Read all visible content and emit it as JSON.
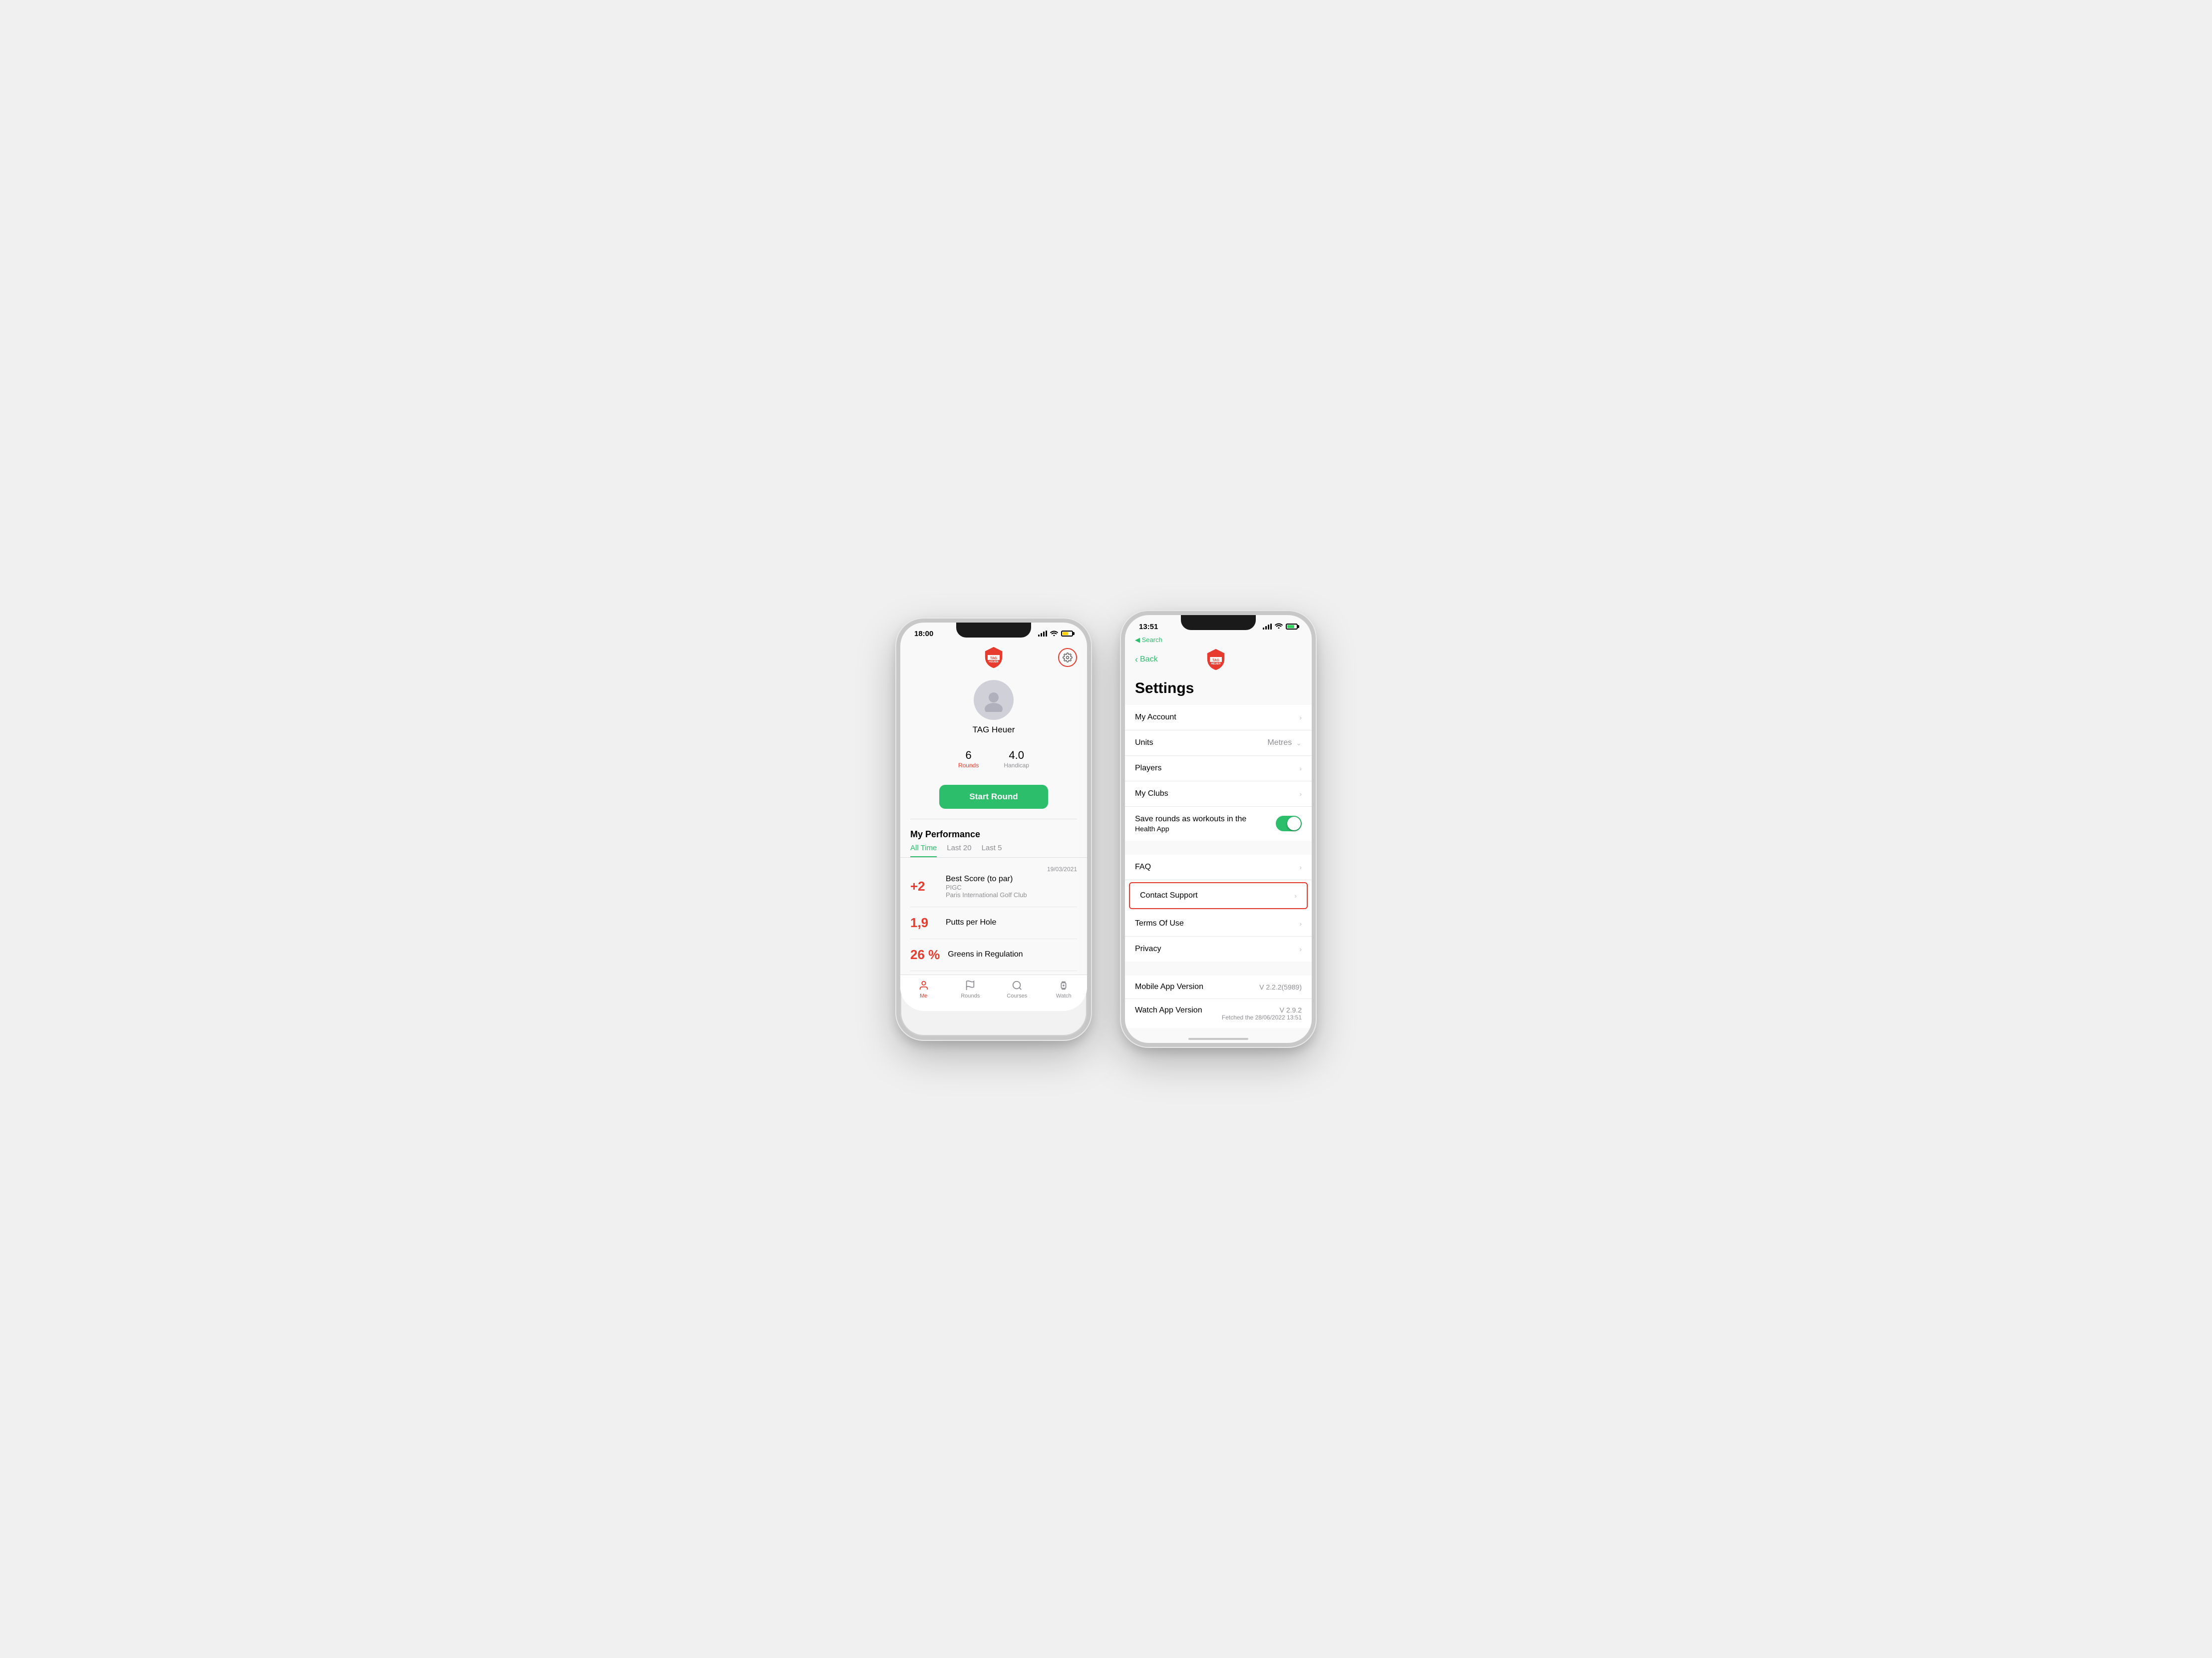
{
  "phone1": {
    "status": {
      "time": "18:00",
      "time_with_arrow": "18:00 ➤"
    },
    "header": {
      "logo_alt": "TAG Heuer Logo"
    },
    "user": {
      "name": "TAG Heuer",
      "avatar_icon": "⛳"
    },
    "stats": {
      "rounds_value": "6",
      "rounds_label": "Rounds",
      "handicap_value": "4.0",
      "handicap_label": "Handicap"
    },
    "cta": {
      "start_round": "Start Round"
    },
    "performance": {
      "title": "My Performance",
      "tabs": [
        "All Time",
        "Last 20",
        "Last 5"
      ],
      "active_tab": 0,
      "items": [
        {
          "value": "+2",
          "title": "Best Score (to par)",
          "subtitle1": "PIGC",
          "subtitle2": "Paris International Golf Club",
          "date": "19/03/2021"
        },
        {
          "value": "1,9",
          "title": "Putts per Hole",
          "subtitle1": "",
          "subtitle2": "",
          "date": ""
        },
        {
          "value": "26 %",
          "title": "Greens in Regulation",
          "subtitle1": "",
          "subtitle2": "",
          "date": ""
        }
      ]
    },
    "bottom_tabs": [
      {
        "label": "Me",
        "icon": "person",
        "active": true
      },
      {
        "label": "Rounds",
        "icon": "flag",
        "active": false
      },
      {
        "label": "Courses",
        "icon": "search",
        "active": false
      },
      {
        "label": "Watch",
        "icon": "watch",
        "active": false
      }
    ]
  },
  "phone2": {
    "status": {
      "time": "13:51"
    },
    "nav": {
      "search_label": "Search",
      "back_label": "Back"
    },
    "title": "Settings",
    "settings_items": [
      {
        "label": "My Account",
        "value": "",
        "type": "arrow"
      },
      {
        "label": "Units",
        "value": "Metres",
        "type": "dropdown"
      },
      {
        "label": "Players",
        "value": "",
        "type": "arrow"
      },
      {
        "label": "My Clubs",
        "value": "",
        "type": "arrow"
      },
      {
        "label": "Save rounds as workouts in the Health App",
        "value": "",
        "type": "toggle"
      },
      {
        "label": "FAQ",
        "value": "",
        "type": "arrow"
      },
      {
        "label": "Contact Support",
        "value": "",
        "type": "arrow",
        "highlighted": true
      },
      {
        "label": "Terms Of Use",
        "value": "",
        "type": "arrow"
      },
      {
        "label": "Privacy",
        "value": "",
        "type": "arrow"
      }
    ],
    "version_items": [
      {
        "label": "Mobile App Version",
        "value": "V 2.2.2(5989)",
        "sub": ""
      },
      {
        "label": "Watch App Version",
        "value": "V 2.9.2",
        "sub": "Fetched the 28/06/2022 13:51"
      }
    ]
  }
}
